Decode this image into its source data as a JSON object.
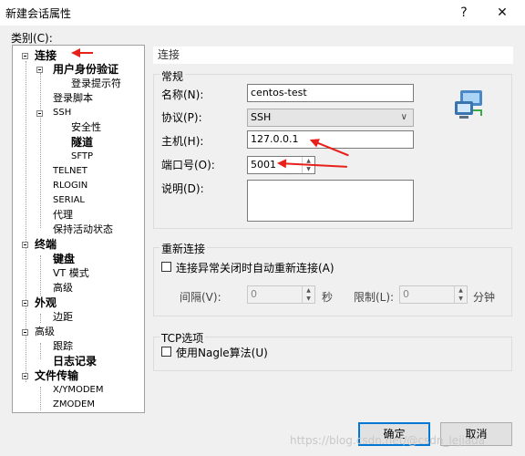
{
  "window": {
    "title": "新建会话属性",
    "help_glyph": "?",
    "close_glyph": "✕"
  },
  "category_label": "类别(C):",
  "tree": [
    {
      "label": "连接",
      "level": 0,
      "bold": true,
      "expander": true
    },
    {
      "label": "用户身份验证",
      "level": 1,
      "bold": true,
      "expander": true
    },
    {
      "label": "登录提示符",
      "level": 2
    },
    {
      "label": "登录脚本",
      "level": 1
    },
    {
      "label": "SSH",
      "level": 1,
      "expander": true
    },
    {
      "label": "安全性",
      "level": 2
    },
    {
      "label": "隧道",
      "level": 2,
      "bold": true
    },
    {
      "label": "SFTP",
      "level": 2
    },
    {
      "label": "TELNET",
      "level": 1
    },
    {
      "label": "RLOGIN",
      "level": 1
    },
    {
      "label": "SERIAL",
      "level": 1
    },
    {
      "label": "代理",
      "level": 1
    },
    {
      "label": "保持活动状态",
      "level": 1
    },
    {
      "label": "终端",
      "level": 0,
      "bold": true,
      "expander": true
    },
    {
      "label": "键盘",
      "level": 1,
      "bold": true
    },
    {
      "label": "VT 模式",
      "level": 1
    },
    {
      "label": "高级",
      "level": 1
    },
    {
      "label": "外观",
      "level": 0,
      "bold": true,
      "expander": true
    },
    {
      "label": "边距",
      "level": 1
    },
    {
      "label": "高级",
      "level": 0,
      "expander": true
    },
    {
      "label": "跟踪",
      "level": 1
    },
    {
      "label": "日志记录",
      "level": 1,
      "bold": true
    },
    {
      "label": "文件传输",
      "level": 0,
      "bold": true,
      "expander": true
    },
    {
      "label": "X/YMODEM",
      "level": 1
    },
    {
      "label": "ZMODEM",
      "level": 1
    }
  ],
  "panel_title": "连接",
  "general": {
    "group_label": "常规",
    "name_label": "名称(N):",
    "name_value": "centos-test",
    "protocol_label": "协议(P):",
    "protocol_value": "SSH",
    "host_label": "主机(H):",
    "host_value": "127.0.0.1",
    "port_label": "端口号(O):",
    "port_value": "5001",
    "desc_label": "说明(D):",
    "desc_value": ""
  },
  "reconnect": {
    "group_label": "重新连接",
    "checkbox_label": "连接异常关闭时自动重新连接(A)",
    "interval_label": "间隔(V):",
    "interval_value": "0",
    "seconds_unit": "秒",
    "limit_label": "限制(L):",
    "limit_value": "0",
    "minutes_unit": "分钟"
  },
  "tcp": {
    "group_label": "TCP选项",
    "nagle_label": "使用Nagle算法(U)"
  },
  "buttons": {
    "ok": "确定",
    "cancel": "取消"
  },
  "watermark": "https://blog.csdn.net/@csdn_lejiada"
}
